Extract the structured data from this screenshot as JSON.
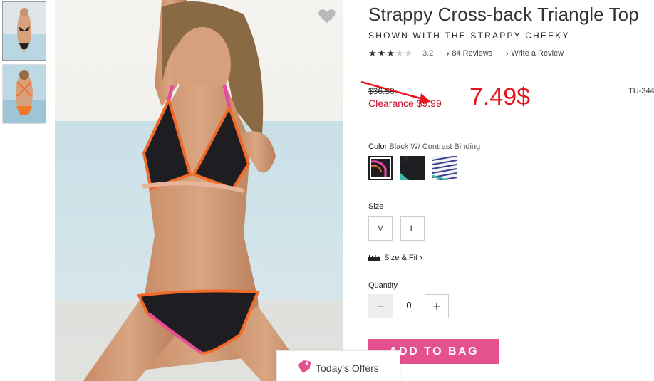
{
  "product": {
    "title": "Strappy Cross-back Triangle Top",
    "subtitle": "SHOWN WITH THE STRAPPY CHEEKY",
    "rating_stars": 3,
    "rating_value": "3.2",
    "reviews_link": "84 Reviews",
    "write_review_link": "Write a Review",
    "sku": "TU-344"
  },
  "price": {
    "original": "$36.50",
    "clearance": "Clearance $9.99",
    "annotation": "7.49$"
  },
  "color": {
    "label": "Color",
    "selected": "Black W/ Contrast Binding"
  },
  "size": {
    "label": "Size",
    "options": [
      "M",
      "L"
    ]
  },
  "size_fit": {
    "label": "Size & Fit"
  },
  "quantity": {
    "label": "Quantity",
    "value": "0",
    "minus": "−",
    "plus": "+"
  },
  "add_to_bag": "ADD TO BAG",
  "offers": {
    "label": "Today's Offers"
  },
  "colors": {
    "accent_pink": "#e4518e",
    "sale_red": "#c8102e",
    "annotation_red": "#e8141c"
  },
  "icons": {
    "favorite": "heart-icon",
    "offers": "tag-icon",
    "size_fit": "ruler-icon"
  }
}
